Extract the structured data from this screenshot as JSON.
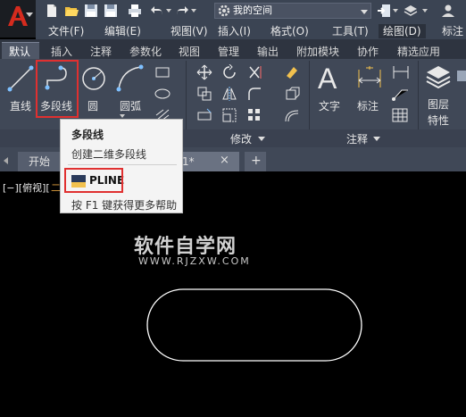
{
  "workspace": {
    "label": "我的空间"
  },
  "menu": [
    "文件(F)",
    "编辑(E)",
    "视图(V)",
    "插入(I)",
    "格式(O)",
    "工具(T)",
    "绘图(D)",
    "标注"
  ],
  "ribbon_tabs": [
    "默认",
    "插入",
    "注释",
    "参数化",
    "视图",
    "管理",
    "输出",
    "附加模块",
    "协作",
    "精选应用"
  ],
  "draw_tools": {
    "line": "直线",
    "polyline": "多段线",
    "circle": "圆",
    "arc": "圆弧"
  },
  "panels": {
    "modify": "修改",
    "annotate": "注释"
  },
  "right_tools": {
    "text": "文字",
    "dimension": "标注",
    "layer_props_line1": "图层",
    "layer_props_line2": "特性"
  },
  "doc_tabs": {
    "start": "开始",
    "drawing_suffix": "1*"
  },
  "viewport_label": {
    "prefix": "[−][俯视][",
    "suffix": "二"
  },
  "tooltip": {
    "title": "多段线",
    "description": "创建二维多段线",
    "command": "PLINE",
    "help": "按 F1 键获得更多帮助"
  },
  "watermark": {
    "title": "软件自学网",
    "url": "WWW.RJZXW.COM"
  },
  "colors": {
    "highlight": "#e03030",
    "ribbon": "#404857",
    "titlebar": "#3b4453",
    "canvas": "#000000"
  }
}
